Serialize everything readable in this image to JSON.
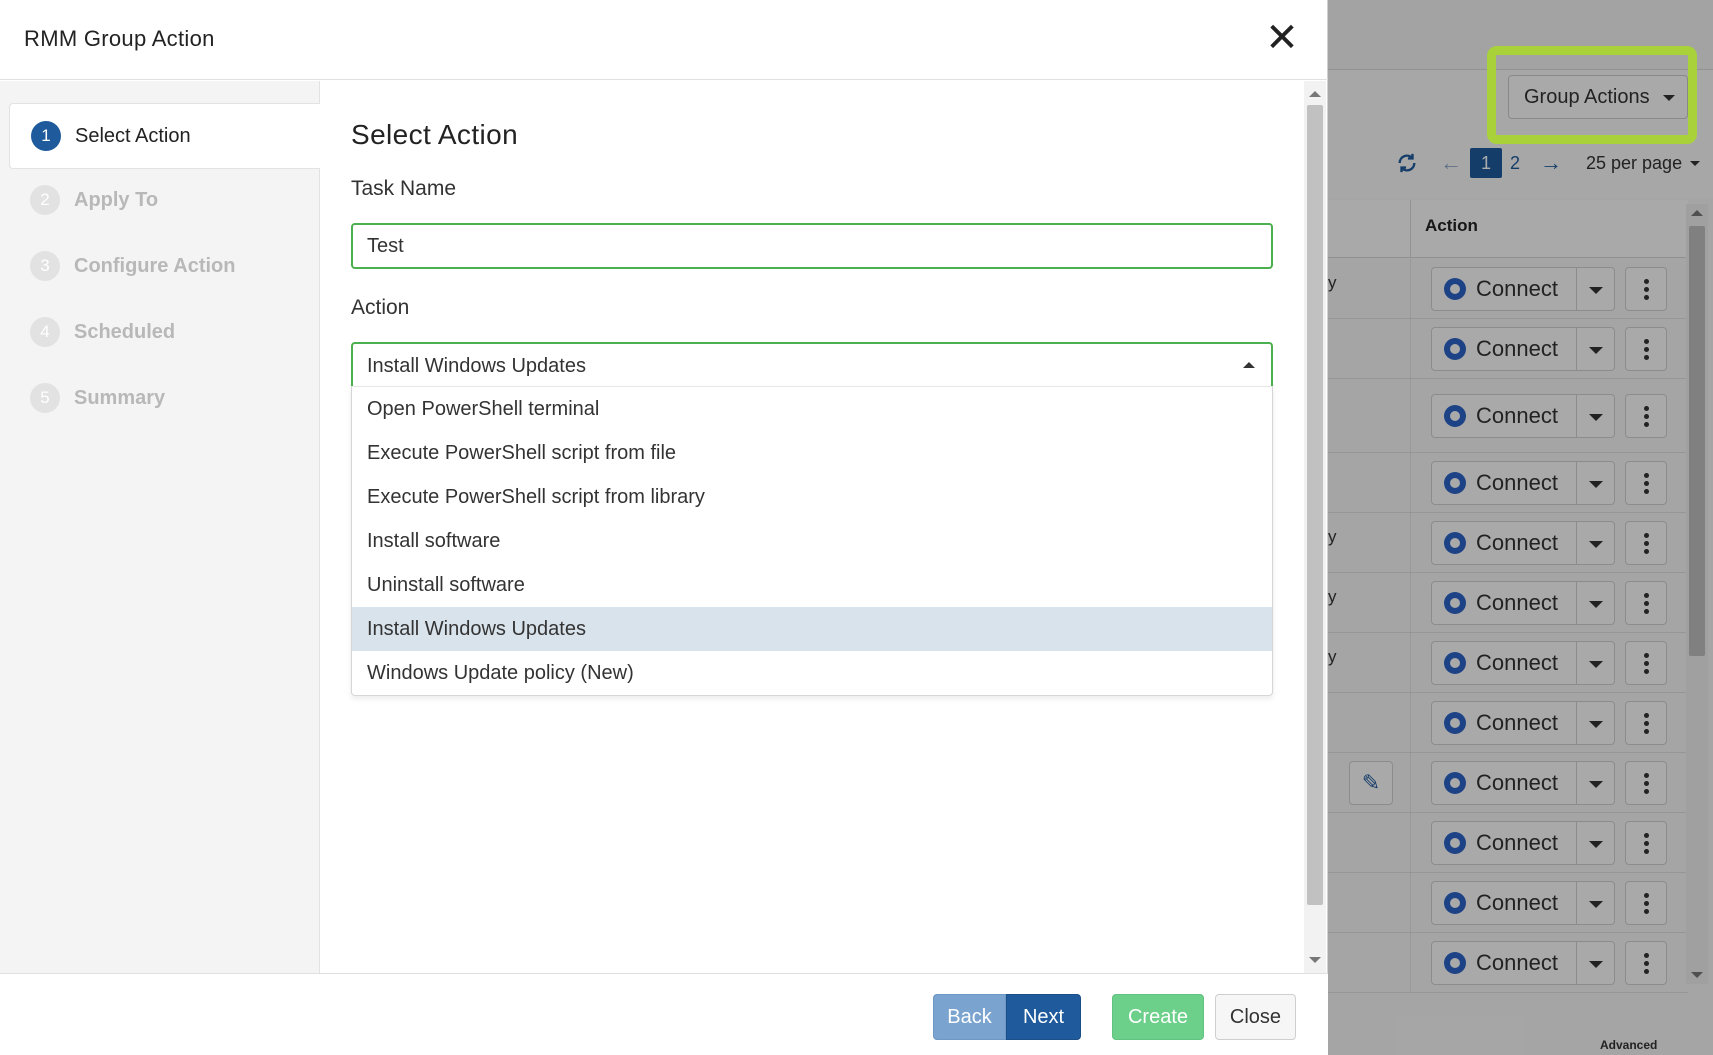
{
  "background": {
    "group_actions_label": "Group Actions",
    "pager": {
      "prev": "←",
      "current_page": "1",
      "next_page": "2",
      "next": "→",
      "per_page": "25 per page"
    },
    "table": {
      "action_header": "Action",
      "row_fragments": [
        "y",
        "",
        "",
        "",
        "y",
        "y",
        "y",
        "",
        "",
        "",
        "",
        ""
      ],
      "connect_label": "Connect"
    },
    "footer_text": "Advanced"
  },
  "modal": {
    "title": "RMM Group Action",
    "close_glyph": "✕",
    "steps": [
      {
        "num": "1",
        "label": "Select Action",
        "active": true
      },
      {
        "num": "2",
        "label": "Apply To",
        "active": false
      },
      {
        "num": "3",
        "label": "Configure Action",
        "active": false
      },
      {
        "num": "4",
        "label": "Scheduled",
        "active": false
      },
      {
        "num": "5",
        "label": "Summary",
        "active": false
      }
    ],
    "section_title": "Select Action",
    "task_name": {
      "label": "Task Name",
      "value": "Test"
    },
    "action": {
      "label": "Action",
      "selected": "Install Windows Updates",
      "options": [
        "Open PowerShell terminal",
        "Execute PowerShell script from file",
        "Execute PowerShell script from library",
        "Install software",
        "Uninstall software",
        "Install Windows Updates",
        "Windows Update policy (New)"
      ],
      "selected_index": 5
    },
    "footer": {
      "back": "Back",
      "next": "Next",
      "create": "Create",
      "close": "Close"
    }
  },
  "colors": {
    "accent": "#1f5b9c",
    "valid_border": "#4caf50",
    "highlight": "#a9d23a",
    "create_button": "#6ccf8a"
  }
}
